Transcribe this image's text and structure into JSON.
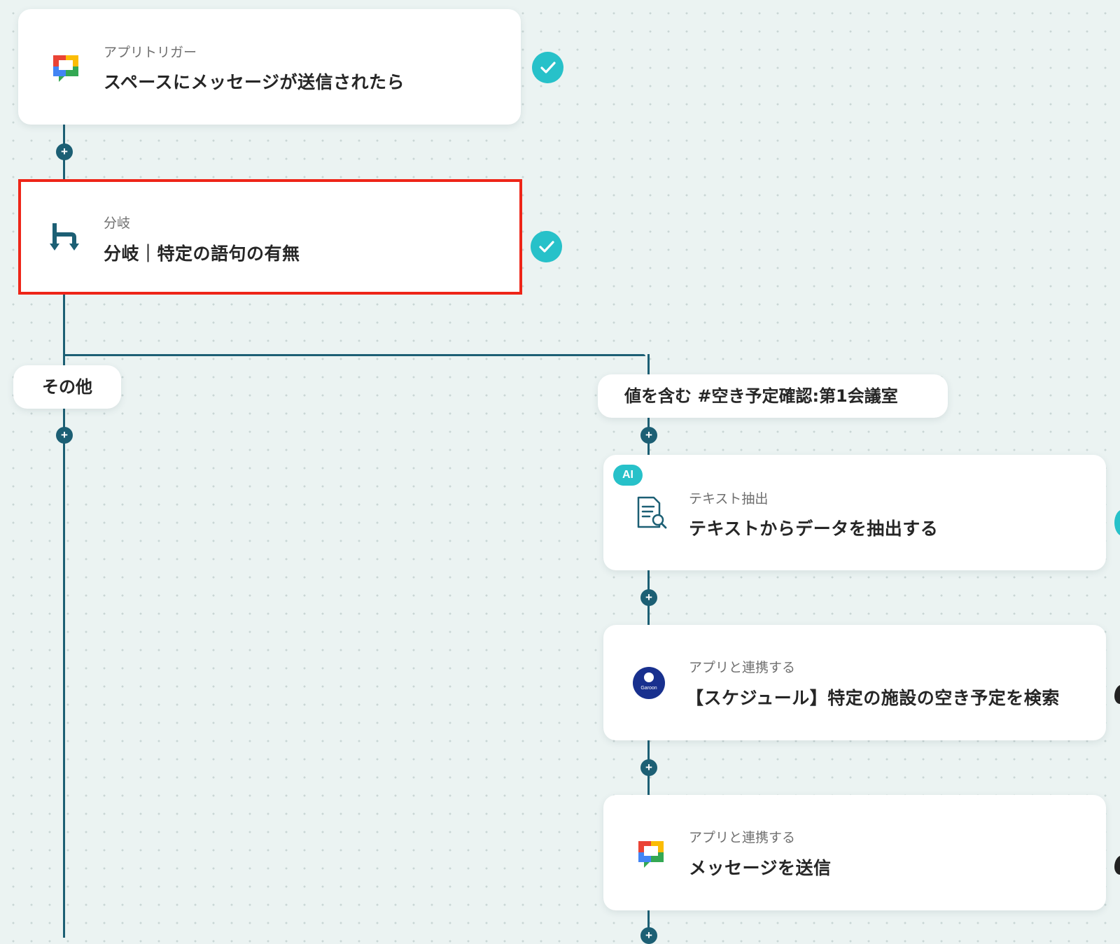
{
  "colors": {
    "line": "#1c5f74",
    "check": "#27c1c9",
    "selected_border": "#ee2518",
    "canvas": "#ebf3f2"
  },
  "steps": [
    {
      "sub": "アプリトリガー",
      "title": "スペースにメッセージが送信されたら",
      "icon": "google-chat-icon",
      "status": "done"
    },
    {
      "sub": "分岐",
      "title": "分岐｜特定の語句の有無",
      "icon": "branch-icon",
      "status": "done",
      "selected": true
    }
  ],
  "branches": {
    "left_label": "その他",
    "right_label": "値を含む #空き予定確認:第1会議室"
  },
  "right_steps": [
    {
      "sub": "テキスト抽出",
      "title": "テキストからデータを抽出する",
      "icon": "text-extract-icon",
      "badge": "AI"
    },
    {
      "sub": "アプリと連携する",
      "title": "【スケジュール】特定の施設の空き予定を検索",
      "icon": "garoon-icon",
      "icon_text": "Garoon"
    },
    {
      "sub": "アプリと連携する",
      "title": "メッセージを送信",
      "icon": "google-chat-icon"
    }
  ],
  "add_button_symbol": "+"
}
